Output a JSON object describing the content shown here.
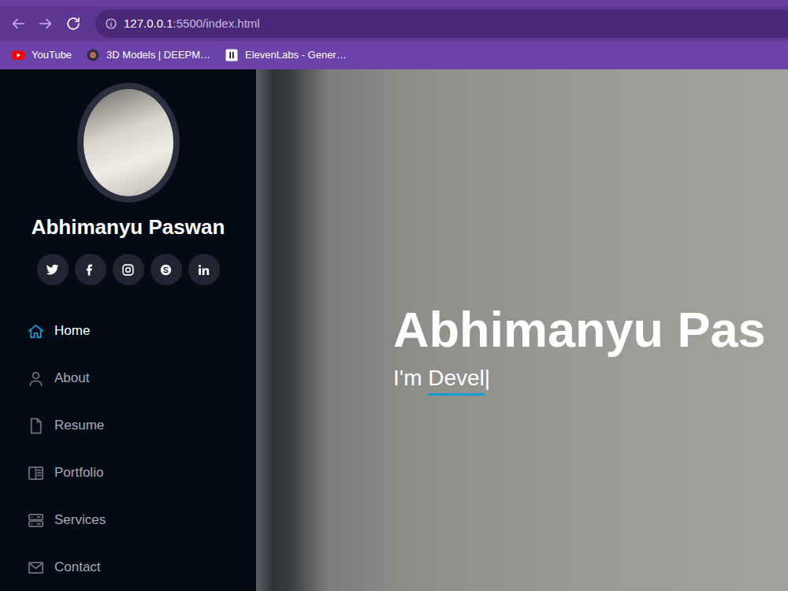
{
  "browser": {
    "url_host": "127.0.0.1",
    "url_path": ":5500/index.html",
    "bookmarks": [
      {
        "label": "YouTube",
        "kind": "youtube"
      },
      {
        "label": "3D Models | DEEPM…",
        "kind": "sphere"
      },
      {
        "label": "ElevenLabs - Gener…",
        "kind": "elevenlabs"
      }
    ]
  },
  "sidebar": {
    "name": "Abhimanyu Paswan",
    "socials": [
      {
        "kind": "twitter"
      },
      {
        "kind": "facebook"
      },
      {
        "kind": "instagram"
      },
      {
        "kind": "skype"
      },
      {
        "kind": "linkedin"
      }
    ],
    "nav": [
      {
        "label": "Home",
        "kind": "home",
        "selected": true
      },
      {
        "label": "About",
        "kind": "person",
        "selected": false
      },
      {
        "label": "Resume",
        "kind": "file",
        "selected": false
      },
      {
        "label": "Portfolio",
        "kind": "portfolio",
        "selected": false
      },
      {
        "label": "Services",
        "kind": "server",
        "selected": false
      },
      {
        "label": "Contact",
        "kind": "envelope",
        "selected": false
      }
    ]
  },
  "hero": {
    "title": "Abhimanyu Pas",
    "prefix": "I'm ",
    "typed": "Devel",
    "cursor": "|"
  }
}
